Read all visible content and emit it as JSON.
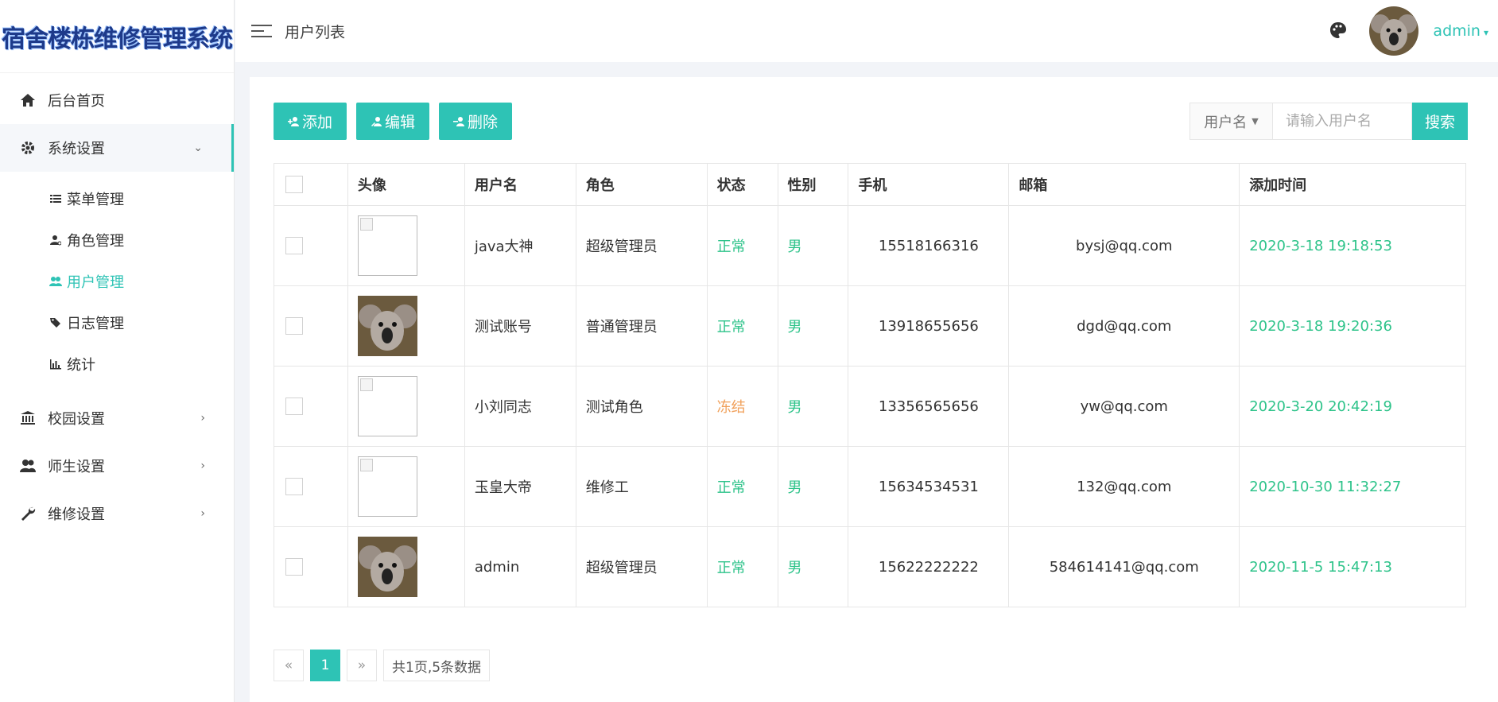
{
  "app": {
    "logo_text": "宿舍楼栋维修管理系统"
  },
  "sidebar": {
    "items": [
      {
        "label": "后台首页",
        "icon": "home-icon"
      },
      {
        "label": "系统设置",
        "icon": "gear-icon",
        "open": true,
        "children": [
          {
            "label": "菜单管理",
            "icon": "list-icon"
          },
          {
            "label": "角色管理",
            "icon": "user-role-icon"
          },
          {
            "label": "用户管理",
            "icon": "users-icon",
            "active": true
          },
          {
            "label": "日志管理",
            "icon": "tags-icon"
          },
          {
            "label": "统计",
            "icon": "bar-chart-icon"
          }
        ]
      },
      {
        "label": "校园设置",
        "icon": "bank-icon"
      },
      {
        "label": "师生设置",
        "icon": "users-icon"
      },
      {
        "label": "维修设置",
        "icon": "wrench-icon"
      }
    ]
  },
  "header": {
    "title": "用户列表",
    "user": "admin"
  },
  "toolbar": {
    "add": "添加",
    "edit": "编辑",
    "delete": "删除"
  },
  "search": {
    "field": "用户名",
    "placeholder": "请输入用户名",
    "button": "搜索"
  },
  "table": {
    "headers": [
      "头像",
      "用户名",
      "角色",
      "状态",
      "性别",
      "手机",
      "邮箱",
      "添加时间"
    ],
    "rows": [
      {
        "avatar": "broken",
        "username": "java大神",
        "role": "超级管理员",
        "status": "正常",
        "gender": "男",
        "phone": "15518166316",
        "email": "bysj@qq.com",
        "time": "2020-3-18 19:18:53"
      },
      {
        "avatar": "koala",
        "username": "测试账号",
        "role": "普通管理员",
        "status": "正常",
        "gender": "男",
        "phone": "13918655656",
        "email": "dgd@qq.com",
        "time": "2020-3-18 19:20:36"
      },
      {
        "avatar": "broken",
        "username": "小刘同志",
        "role": "测试角色",
        "status": "冻结",
        "gender": "男",
        "phone": "13356565656",
        "email": "yw@qq.com",
        "time": "2020-3-20 20:42:19"
      },
      {
        "avatar": "broken",
        "username": "玉皇大帝",
        "role": "维修工",
        "status": "正常",
        "gender": "男",
        "phone": "15634534531",
        "email": "132@qq.com",
        "time": "2020-10-30 11:32:27"
      },
      {
        "avatar": "koala",
        "username": "admin",
        "role": "超级管理员",
        "status": "正常",
        "gender": "男",
        "phone": "15622222222",
        "email": "584614141@qq.com",
        "time": "2020-11-5 15:47:13"
      }
    ]
  },
  "pager": {
    "prev": "«",
    "current": "1",
    "next": "»",
    "info": "共1页,5条数据"
  },
  "colors": {
    "accent": "#2ec3b5",
    "ok": "#2ec38a",
    "warn": "#f0a05a"
  }
}
